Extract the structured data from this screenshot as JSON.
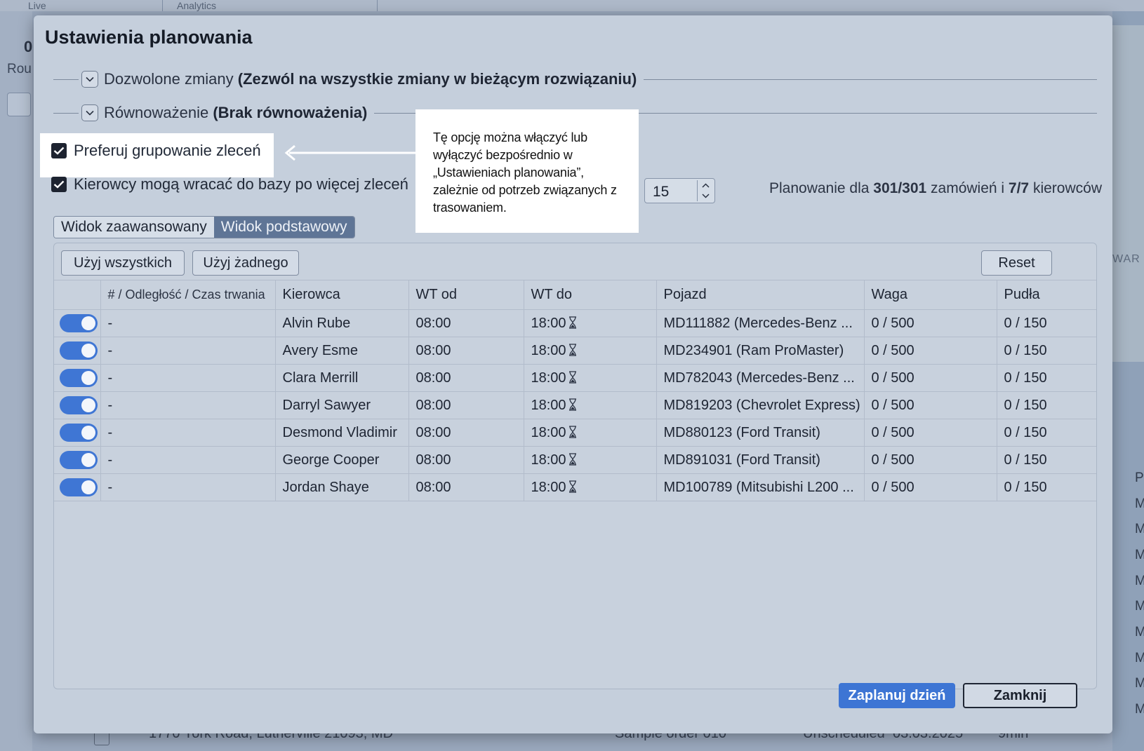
{
  "background": {
    "tabs": [
      "Live",
      "Analytics"
    ],
    "left_count": "0",
    "left_label": "Rou",
    "right_label": "WAR",
    "right_column_letters": [
      "P",
      "M",
      "M",
      "M",
      "M",
      "M",
      "M",
      "M",
      "M",
      "M"
    ],
    "bottom_row": {
      "address": "1770 York Road, Lutherville 21093, MD",
      "name": "Sample order 010",
      "status": "Unscheduled",
      "date": "03.03.2025",
      "duration": "9min"
    }
  },
  "modal": {
    "title": "Ustawienia planowania",
    "sections": [
      {
        "label": "Dozwolone zmiany",
        "value": "(Zezwól na wszystkie zmiany w bieżącym rozwiązaniu)"
      },
      {
        "label": "Równoważenie",
        "value": "(Brak równoważenia)"
      }
    ],
    "options": [
      {
        "label": "Preferuj grupowanie zleceń",
        "checked": true
      },
      {
        "label": "Kierowcy mogą wracać do bazy po więcej zleceń",
        "checked": true
      }
    ],
    "callout_text": "Tę opcję można włączyć lub wyłączyć bezpośrednio w „Ustawieniach planowania”, zależnie od potrzeb związanych z trasowaniem.",
    "stepper_value": "15",
    "plan_info": {
      "prefix": "Planowanie dla ",
      "orders": "301/301",
      "middle": " zamówień i ",
      "drivers": "7/7",
      "suffix": " kierowców"
    },
    "view_options": [
      "Widok zaawansowany",
      "Widok podstawowy"
    ],
    "active_view": "Widok podstawowy",
    "buttons": {
      "use_all": "Użyj wszystkich",
      "use_none": "Użyj żadnego",
      "reset": "Reset",
      "plan_day": "Zaplanuj dzień",
      "close": "Zamknij"
    },
    "table": {
      "columns": [
        "",
        "# / Odległość / Czas trwania",
        "Kierowca",
        "WT od",
        "WT do",
        "Pojazd",
        "Waga",
        "Pudła"
      ],
      "rows": [
        {
          "enabled": true,
          "dist": "-",
          "driver": "Alvin Rube",
          "from": "08:00",
          "to": "18:00",
          "vehicle": "MD111882 (Mercedes-Benz ...",
          "weight": "0 / 500",
          "boxes": "0 / 150"
        },
        {
          "enabled": true,
          "dist": "-",
          "driver": "Avery Esme",
          "from": "08:00",
          "to": "18:00",
          "vehicle": "MD234901 (Ram ProMaster)",
          "weight": "0 / 500",
          "boxes": "0 / 150"
        },
        {
          "enabled": true,
          "dist": "-",
          "driver": "Clara Merrill",
          "from": "08:00",
          "to": "18:00",
          "vehicle": "MD782043 (Mercedes-Benz ...",
          "weight": "0 / 500",
          "boxes": "0 / 150"
        },
        {
          "enabled": true,
          "dist": "-",
          "driver": "Darryl Sawyer",
          "from": "08:00",
          "to": "18:00",
          "vehicle": "MD819203 (Chevrolet Express)",
          "weight": "0 / 500",
          "boxes": "0 / 150"
        },
        {
          "enabled": true,
          "dist": "-",
          "driver": "Desmond Vladimir",
          "from": "08:00",
          "to": "18:00",
          "vehicle": "MD880123 (Ford Transit)",
          "weight": "0 / 500",
          "boxes": "0 / 150"
        },
        {
          "enabled": true,
          "dist": "-",
          "driver": "George Cooper",
          "from": "08:00",
          "to": "18:00",
          "vehicle": "MD891031 (Ford Transit)",
          "weight": "0 / 500",
          "boxes": "0 / 150"
        },
        {
          "enabled": true,
          "dist": "-",
          "driver": "Jordan Shaye",
          "from": "08:00",
          "to": "18:00",
          "vehicle": "MD100789 (Mitsubishi L200 ...",
          "weight": "0 / 500",
          "boxes": "0 / 150"
        }
      ]
    }
  },
  "colors": {
    "accent": "#3d75d4",
    "active_view_bg": "#5f7596",
    "modal_bg": "#c5cfdc"
  },
  "icons": {
    "section_toggle": "chevron-down-icon",
    "time_limit": "hourglass-icon",
    "stepper_up": "chevron-up-icon",
    "stepper_down": "chevron-down-icon",
    "callout_pointer": "arrow-left-icon"
  }
}
